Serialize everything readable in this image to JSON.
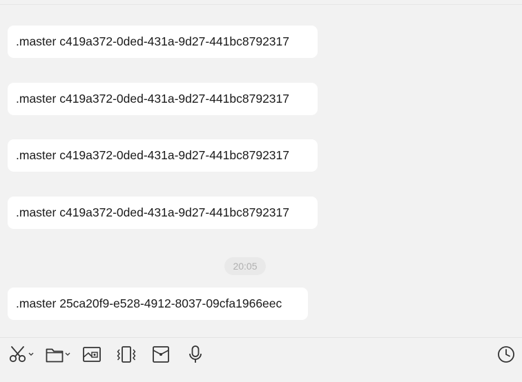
{
  "messages": [
    {
      "text": ".master c419a372-0ded-431a-9d27-441bc8792317"
    },
    {
      "text": ".master c419a372-0ded-431a-9d27-441bc8792317"
    },
    {
      "text": ".master c419a372-0ded-431a-9d27-441bc8792317"
    },
    {
      "text": ".master c419a372-0ded-431a-9d27-441bc8792317"
    },
    {
      "text": ".master 25ca20f9-e528-4912-8037-09cfa1966eec"
    }
  ],
  "timestamp": "20:05",
  "toolbar": {
    "icons": [
      "scissors-icon",
      "folder-icon",
      "screenshot-icon",
      "vibrate-icon",
      "red-envelope-icon",
      "microphone-icon",
      "history-clock-icon"
    ]
  },
  "colors": {
    "background": "#f2f2f2",
    "bubble": "#ffffff",
    "text": "#1a1a1a",
    "icon": "#333333",
    "timestamp_text": "#b0b0b0"
  }
}
